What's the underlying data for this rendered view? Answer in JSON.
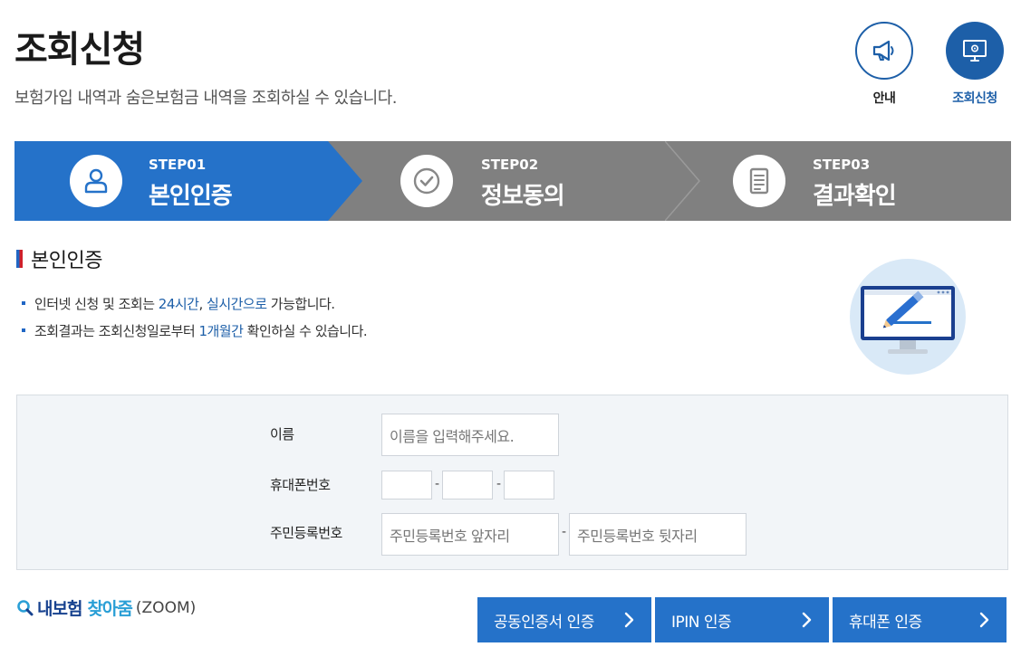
{
  "header": {
    "title": "조회신청",
    "subtitle": "보험가입 내역과 숨은보험금 내역을 조회하실 수 있습니다."
  },
  "top_buttons": {
    "info_label": "안내",
    "query_label": "조회신청"
  },
  "steps": [
    {
      "number": "STEP01",
      "name": "본인인증",
      "icon": "user-icon",
      "active": true
    },
    {
      "number": "STEP02",
      "name": "정보동의",
      "icon": "check-circle-icon",
      "active": false
    },
    {
      "number": "STEP03",
      "name": "결과확인",
      "icon": "document-icon",
      "active": false
    }
  ],
  "section": {
    "title": "본인인증",
    "bullet1": {
      "before": "인터넷 신청 및 조회는 ",
      "hl1": "24시간",
      "comma": ", ",
      "hl2": "실시간으로",
      "after": " 가능합니다."
    },
    "bullet2": {
      "before": "조회결과는 조회신청일로부터 ",
      "hl": "1개월간",
      "after": " 확인하실 수 있습니다."
    }
  },
  "form": {
    "name_label": "이름",
    "name_placeholder": "이름을 입력해주세요.",
    "phone_label": "휴대폰번호",
    "phone_sep": "-",
    "rrn_label": "주민등록번호",
    "rrn_front_placeholder": "주민등록번호 앞자리",
    "rrn_back_placeholder": "주민등록번호 뒷자리",
    "rrn_sep": "-"
  },
  "footer": {
    "logo_part1": "내보험",
    "logo_part2": "찾아줌",
    "logo_part3": "(ZOOM)",
    "buttons": [
      "공동인증서 인증",
      "IPIN 인증",
      "휴대폰 인증"
    ]
  },
  "colors": {
    "primary": "#2572c9",
    "dark_blue": "#1d5fa8",
    "step_inactive": "#808080"
  }
}
